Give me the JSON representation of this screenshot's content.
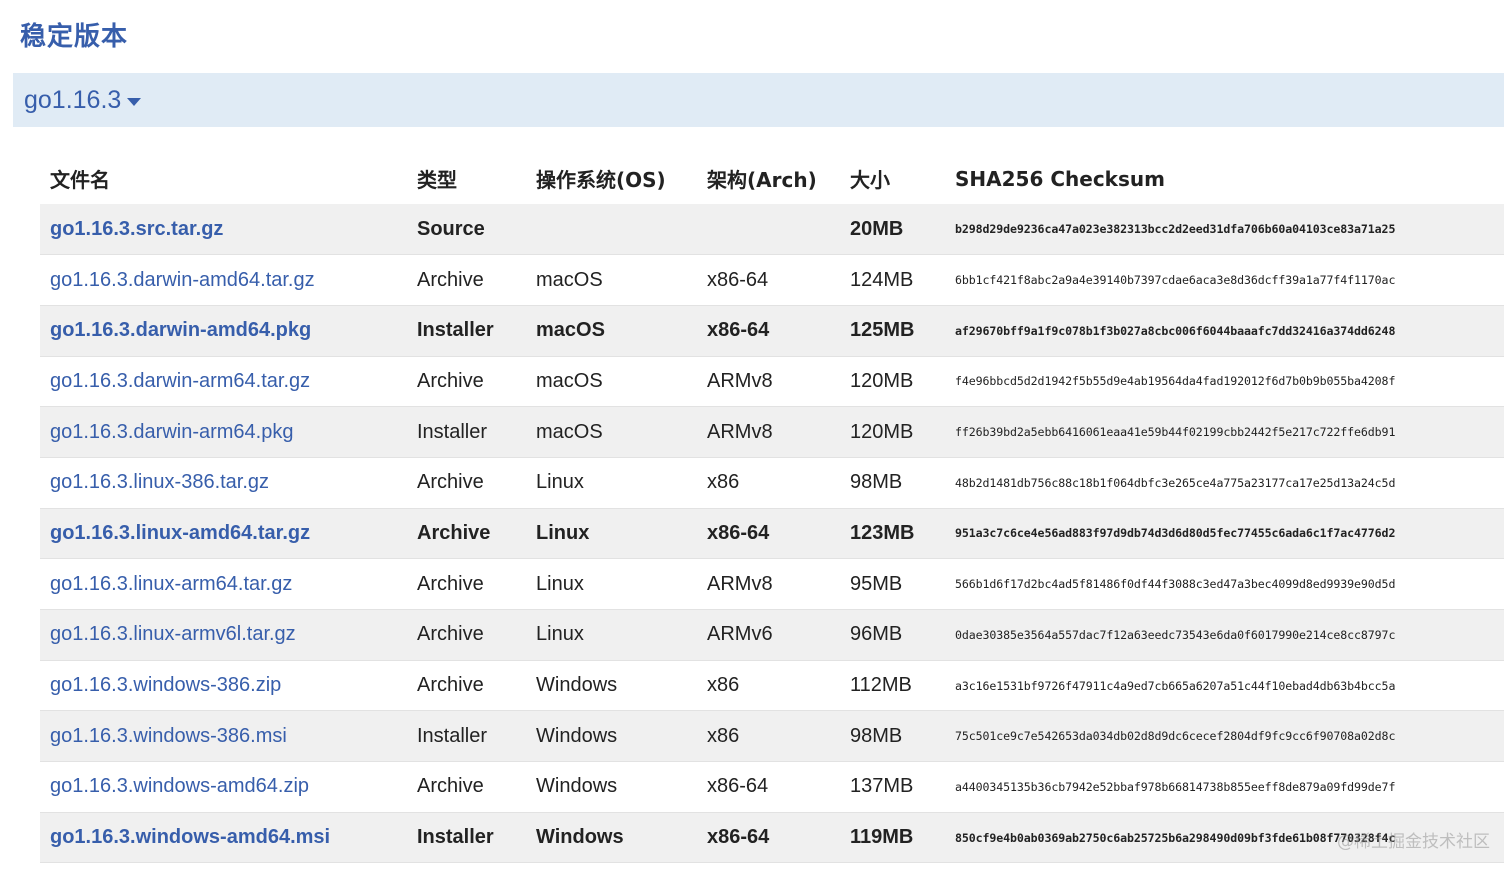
{
  "section_title": "稳定版本",
  "version": {
    "label": "go1.16.3"
  },
  "table": {
    "headers": {
      "filename": "文件名",
      "kind": "类型",
      "os": "操作系统(OS)",
      "arch": "架构(Arch)",
      "size": "大小",
      "checksum": "SHA256 Checksum"
    },
    "rows": [
      {
        "filename": "go1.16.3.src.tar.gz",
        "kind": "Source",
        "os": "",
        "arch": "",
        "size": "20MB",
        "checksum": "b298d29de9236ca47a023e382313bcc2d2eed31dfa706b60a04103ce83a71a25",
        "highlight": true
      },
      {
        "filename": "go1.16.3.darwin-amd64.tar.gz",
        "kind": "Archive",
        "os": "macOS",
        "arch": "x86-64",
        "size": "124MB",
        "checksum": "6bb1cf421f8abc2a9a4e39140b7397cdae6aca3e8d36dcff39a1a77f4f1170ac",
        "highlight": false
      },
      {
        "filename": "go1.16.3.darwin-amd64.pkg",
        "kind": "Installer",
        "os": "macOS",
        "arch": "x86-64",
        "size": "125MB",
        "checksum": "af29670bff9a1f9c078b1f3b027a8cbc006f6044baaafc7dd32416a374dd6248",
        "highlight": true
      },
      {
        "filename": "go1.16.3.darwin-arm64.tar.gz",
        "kind": "Archive",
        "os": "macOS",
        "arch": "ARMv8",
        "size": "120MB",
        "checksum": "f4e96bbcd5d2d1942f5b55d9e4ab19564da4fad192012f6d7b0b9b055ba4208f",
        "highlight": false
      },
      {
        "filename": "go1.16.3.darwin-arm64.pkg",
        "kind": "Installer",
        "os": "macOS",
        "arch": "ARMv8",
        "size": "120MB",
        "checksum": "ff26b39bd2a5ebb6416061eaa41e59b44f02199cbb2442f5e217c722ffe6db91",
        "highlight": false
      },
      {
        "filename": "go1.16.3.linux-386.tar.gz",
        "kind": "Archive",
        "os": "Linux",
        "arch": "x86",
        "size": "98MB",
        "checksum": "48b2d1481db756c88c18b1f064dbfc3e265ce4a775a23177ca17e25d13a24c5d",
        "highlight": false
      },
      {
        "filename": "go1.16.3.linux-amd64.tar.gz",
        "kind": "Archive",
        "os": "Linux",
        "arch": "x86-64",
        "size": "123MB",
        "checksum": "951a3c7c6ce4e56ad883f97d9db74d3d6d80d5fec77455c6ada6c1f7ac4776d2",
        "highlight": true
      },
      {
        "filename": "go1.16.3.linux-arm64.tar.gz",
        "kind": "Archive",
        "os": "Linux",
        "arch": "ARMv8",
        "size": "95MB",
        "checksum": "566b1d6f17d2bc4ad5f81486f0df44f3088c3ed47a3bec4099d8ed9939e90d5d",
        "highlight": false
      },
      {
        "filename": "go1.16.3.linux-armv6l.tar.gz",
        "kind": "Archive",
        "os": "Linux",
        "arch": "ARMv6",
        "size": "96MB",
        "checksum": "0dae30385e3564a557dac7f12a63eedc73543e6da0f6017990e214ce8cc8797c",
        "highlight": false
      },
      {
        "filename": "go1.16.3.windows-386.zip",
        "kind": "Archive",
        "os": "Windows",
        "arch": "x86",
        "size": "112MB",
        "checksum": "a3c16e1531bf9726f47911c4a9ed7cb665a6207a51c44f10ebad4db63b4bcc5a",
        "highlight": false
      },
      {
        "filename": "go1.16.3.windows-386.msi",
        "kind": "Installer",
        "os": "Windows",
        "arch": "x86",
        "size": "98MB",
        "checksum": "75c501ce9c7e542653da034db02d8d9dc6cecef2804df9fc9cc6f90708a02d8c",
        "highlight": false
      },
      {
        "filename": "go1.16.3.windows-amd64.zip",
        "kind": "Archive",
        "os": "Windows",
        "arch": "x86-64",
        "size": "137MB",
        "checksum": "a4400345135b36cb7942e52bbaf978b66814738b855eeff8de879a09fd99de7f",
        "highlight": false
      },
      {
        "filename": "go1.16.3.windows-amd64.msi",
        "kind": "Installer",
        "os": "Windows",
        "arch": "x86-64",
        "size": "119MB",
        "checksum": "850cf9e4b0ab0369ab2750c6ab25725b6a298490d09bf3fde61b08f770328f4c",
        "highlight": true
      }
    ]
  },
  "watermark": "@稀土掘金技术社区"
}
